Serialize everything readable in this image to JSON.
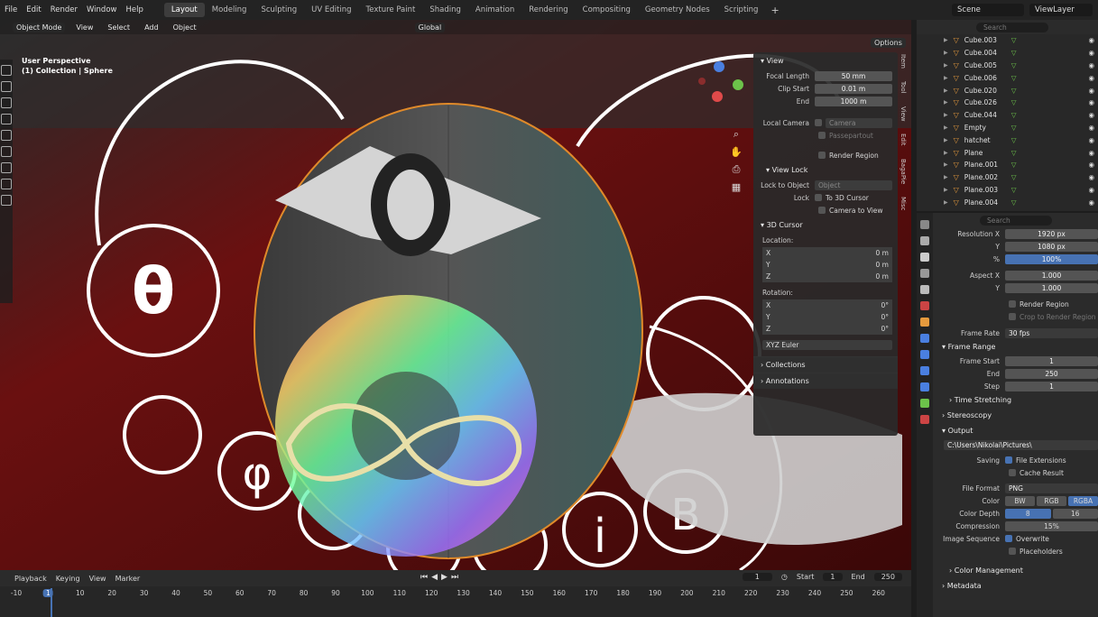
{
  "menubar": {
    "items": [
      "File",
      "Edit",
      "Render",
      "Window",
      "Help"
    ],
    "workspaces": [
      "Layout",
      "Modeling",
      "Sculpting",
      "UV Editing",
      "Texture Paint",
      "Shading",
      "Animation",
      "Rendering",
      "Compositing",
      "Geometry Nodes",
      "Scripting"
    ],
    "add_tab": "+",
    "scene": "Scene",
    "view_layer": "ViewLayer"
  },
  "viewport": {
    "mode": "Object Mode",
    "menu": [
      "View",
      "Select",
      "Add",
      "Object"
    ],
    "orientation": "Global",
    "options": "Options",
    "overlay_title": "User Perspective",
    "overlay_sub": "(1) Collection | Sphere"
  },
  "npanel": {
    "view_header": "View",
    "focal_length_label": "Focal Length",
    "focal_length": "50 mm",
    "clip_start_label": "Clip Start",
    "clip_start": "0.01 m",
    "clip_end_label": "End",
    "clip_end": "1000 m",
    "local_camera_label": "Local Camera",
    "local_camera": "Camera",
    "passepartout": "Passepartout",
    "render_region": "Render Region",
    "view_lock_header": "View Lock",
    "lock_to_object_label": "Lock to Object",
    "lock_to_object": "Object",
    "lock_label": "Lock",
    "to_3d_cursor": "To 3D Cursor",
    "camera_to_view": "Camera to View",
    "cursor_header": "3D Cursor",
    "location_label": "Location:",
    "loc_x_label": "X",
    "loc_x": "0 m",
    "loc_y_label": "Y",
    "loc_y": "0 m",
    "loc_z_label": "Z",
    "loc_z": "0 m",
    "rotation_label": "Rotation:",
    "rot_x_label": "X",
    "rot_x": "0°",
    "rot_y_label": "Y",
    "rot_y": "0°",
    "rot_z_label": "Z",
    "rot_z": "0°",
    "rotation_mode": "XYZ Euler",
    "collections": "Collections",
    "annotations": "Annotations",
    "side_tabs": [
      "Item",
      "Tool",
      "View",
      "Edit",
      "BagaPie",
      "Misc"
    ]
  },
  "outliner": {
    "search_placeholder": "Search",
    "rows": [
      "Cube.003",
      "Cube.004",
      "Cube.005",
      "Cube.006",
      "Cube.020",
      "Cube.026",
      "Cube.044",
      "Empty",
      "hatchet",
      "Plane",
      "Plane.001",
      "Plane.002",
      "Plane.003",
      "Plane.004"
    ]
  },
  "properties": {
    "search_placeholder": "Search",
    "resolution_x_label": "Resolution X",
    "resolution_x": "1920 px",
    "resolution_y_label": "Y",
    "resolution_y": "1080 px",
    "resolution_pct_label": "%",
    "resolution_pct": "100%",
    "aspect_x_label": "Aspect X",
    "aspect_x": "1.000",
    "aspect_y_label": "Y",
    "aspect_y": "1.000",
    "render_region": "Render Region",
    "crop_to_render_region": "Crop to Render Region",
    "frame_rate_label": "Frame Rate",
    "frame_rate": "30 fps",
    "frame_range_header": "Frame Range",
    "frame_start_label": "Frame Start",
    "frame_start": "1",
    "frame_end_label": "End",
    "frame_end": "250",
    "frame_step_label": "Step",
    "frame_step": "1",
    "time_stretching": "Time Stretching",
    "stereoscopy": "Stereoscopy",
    "output_header": "Output",
    "output_path": "C:\\Users\\Nikolai\\Pictures\\",
    "saving_label": "Saving",
    "file_extensions": "File Extensions",
    "cache_result": "Cache Result",
    "file_format_label": "File Format",
    "file_format": "PNG",
    "color_label": "Color",
    "color_options": [
      "BW",
      "RGB",
      "RGBA"
    ],
    "color_selected": 2,
    "color_depth_label": "Color Depth",
    "color_depth_options": [
      "8",
      "16"
    ],
    "compression_label": "Compression",
    "compression": "15%",
    "compression_fraction": 0.15,
    "image_sequence_label": "Image Sequence",
    "overwrite": "Overwrite",
    "placeholders": "Placeholders",
    "color_management": "Color Management",
    "metadata": "Metadata"
  },
  "timeline": {
    "menus": [
      "Playback",
      "Keying",
      "View",
      "Marker"
    ],
    "current_frame": "1",
    "start_label": "Start",
    "start": "1",
    "end_label": "End",
    "end": "250",
    "ruler": [
      "-10",
      "1",
      "10",
      "20",
      "30",
      "40",
      "50",
      "60",
      "70",
      "80",
      "90",
      "100",
      "110",
      "120",
      "130",
      "140",
      "150",
      "160",
      "170",
      "180",
      "190",
      "200",
      "210",
      "220",
      "230",
      "240",
      "250",
      "260"
    ]
  },
  "colors": {
    "accent": "#4772b3",
    "object_orange": "#e59a3d",
    "mesh_green": "#6cc24a"
  }
}
